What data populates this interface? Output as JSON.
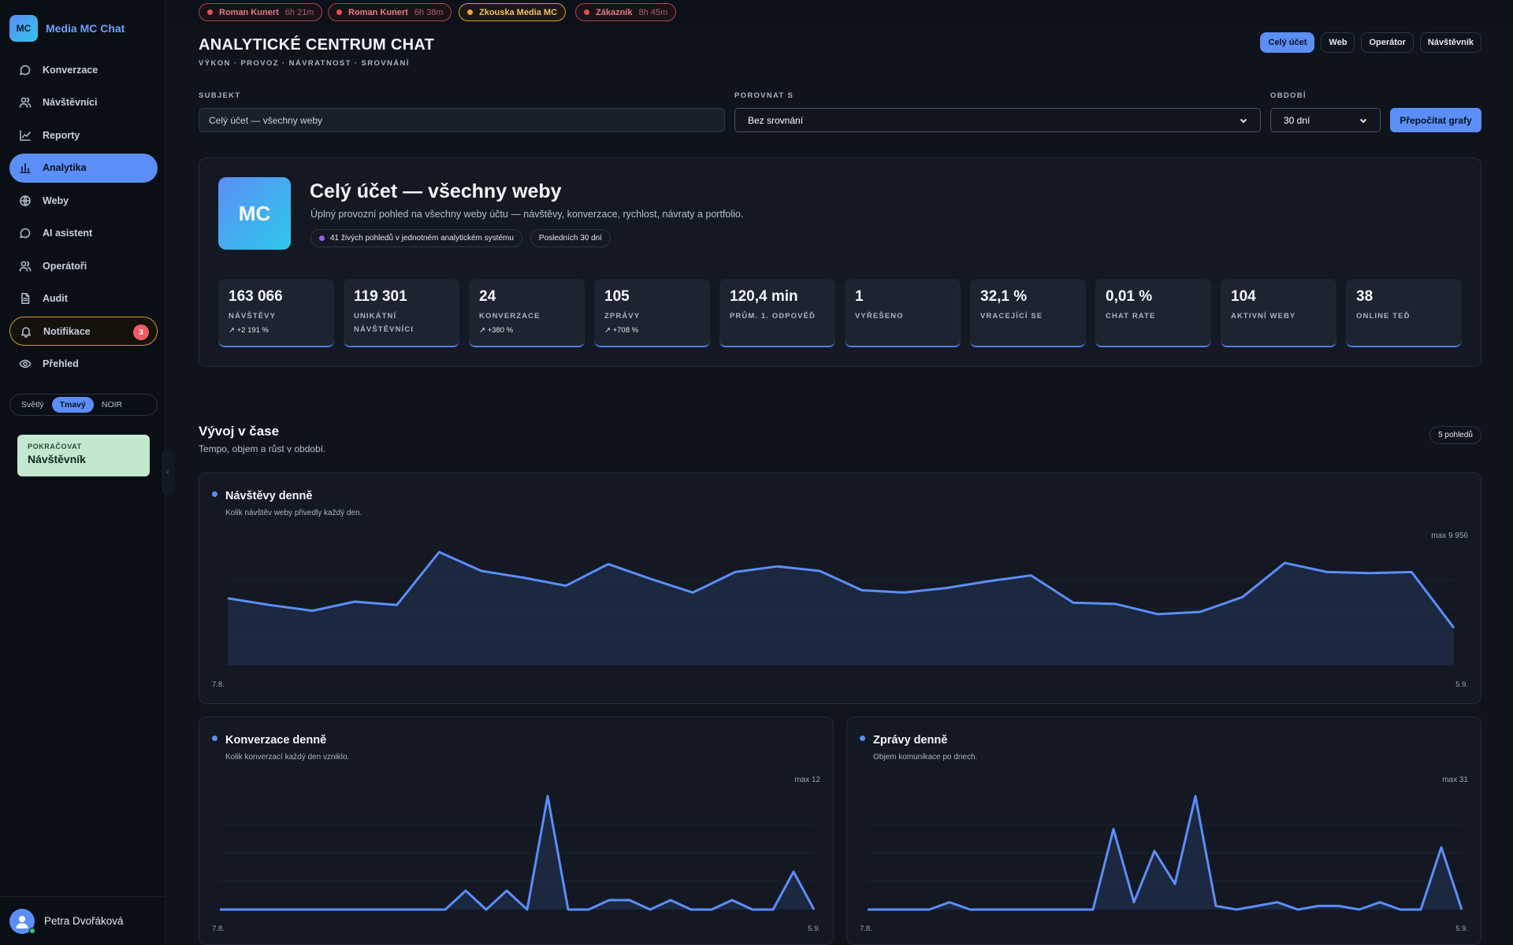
{
  "app": {
    "logo": "MC",
    "name": "Media MC Chat"
  },
  "sidebar": {
    "items": [
      {
        "label": "Konverzace",
        "icon": "chat-bubble-icon"
      },
      {
        "label": "Návštěvníci",
        "icon": "users-icon"
      },
      {
        "label": "Reporty",
        "icon": "line-chart-icon"
      },
      {
        "label": "Analytika",
        "icon": "bar-chart-icon",
        "active": true
      },
      {
        "label": "Weby",
        "icon": "globe-icon"
      },
      {
        "label": "AI asistent",
        "icon": "chat-bubble-icon"
      },
      {
        "label": "Operátoři",
        "icon": "users-icon"
      },
      {
        "label": "Audit",
        "icon": "document-icon"
      },
      {
        "label": "Notifikace",
        "icon": "bell-icon",
        "badge": "3"
      },
      {
        "label": "Přehled",
        "icon": "eye-icon"
      }
    ],
    "theme": {
      "options": [
        "Světlý",
        "Tmavý",
        "NOIR"
      ],
      "selected": "Tmavý"
    },
    "continue_card": {
      "label": "POKRAČOVAT",
      "value": "Návštěvník"
    },
    "user": {
      "name": "Petra Dvořáková"
    }
  },
  "sessions": [
    {
      "name": "Roman Kunert",
      "time": "6h 21m"
    },
    {
      "name": "Roman Kunert",
      "time": "6h 38m"
    },
    {
      "name": "Zkouska Media MC",
      "time": "",
      "active": true
    },
    {
      "name": "Zákazník",
      "time": "8h 45m"
    }
  ],
  "header": {
    "title": "ANALYTICKÉ CENTRUM CHAT",
    "subtitle": "VÝKON · PROVOZ · NÁVRATNOST · SROVNÁNÍ",
    "view_tabs": [
      "Celý účet",
      "Web",
      "Operátor",
      "Návštěvník"
    ],
    "active_view": "Celý účet"
  },
  "filters": {
    "subject_label": "SUBJEKT",
    "subject_value": "Celý účet — všechny weby",
    "compare_label": "POROVNAT S",
    "compare_value": "Bez srovnání",
    "period_label": "OBDOBÍ",
    "period_value": "30 dní",
    "recalc_label": "Přepočítat grafy"
  },
  "overview": {
    "logo": "MC",
    "title": "Celý účet — všechny weby",
    "description": "Úplný provozní pohled na všechny weby účtu — návštěvy, konverzace, rychlost, návraty a portfolio.",
    "chip_live": "41 živých pohledů v jednotném analytickém systému",
    "chip_period": "Posledních 30 dní",
    "kpis": [
      {
        "value": "163 066",
        "label": "NÁVŠTĚVY",
        "delta": "↗ +2 191 %"
      },
      {
        "value": "119 301",
        "label": "UNIKÁTNÍ NÁVŠTĚVNÍCI",
        "delta": ""
      },
      {
        "value": "24",
        "label": "KONVERZACE",
        "delta": "↗ +380 %"
      },
      {
        "value": "105",
        "label": "ZPRÁVY",
        "delta": "↗ +708 %"
      },
      {
        "value": "120,4 min",
        "label": "PRŮM. 1. ODPOVĚĎ",
        "delta": ""
      },
      {
        "value": "1",
        "label": "VYŘEŠENO",
        "delta": ""
      },
      {
        "value": "32,1 %",
        "label": "VRACEJÍCÍ SE",
        "delta": ""
      },
      {
        "value": "0,01 %",
        "label": "CHAT RATE",
        "delta": ""
      },
      {
        "value": "104",
        "label": "AKTIVNÍ WEBY",
        "delta": ""
      },
      {
        "value": "38",
        "label": "ONLINE TEĎ",
        "delta": ""
      }
    ]
  },
  "timeline": {
    "title": "Vývoj v čase",
    "subtitle": "Tempo, objem a růst v období.",
    "count": "5 pohledů"
  },
  "chart_data": [
    {
      "type": "area",
      "title": "Návštěvy denně",
      "subtitle": "Kolik návštěv weby přivedly každý den.",
      "max_label": "max 9 956",
      "ylim": [
        0,
        9956
      ],
      "x_start": "7.8.",
      "x_end": "5.9.",
      "values": [
        5900,
        5300,
        4800,
        5600,
        5300,
        9956,
        8300,
        7700,
        7000,
        8900,
        7600,
        6400,
        8200,
        8700,
        8300,
        6600,
        6400,
        6800,
        7400,
        7900,
        5500,
        5400,
        4500,
        4700,
        6000,
        9000,
        8200,
        8100,
        8200,
        3300
      ],
      "color": "#5b8ef7"
    },
    {
      "type": "area",
      "title": "Konverzace denně",
      "subtitle": "Kolik konverzací každý den vzniklo.",
      "max_label": "max 12",
      "ylim": [
        0,
        12
      ],
      "x_start": "7.8.",
      "x_end": "5.9.",
      "values": [
        0,
        0,
        0,
        0,
        0,
        0,
        0,
        0,
        0,
        0,
        0,
        0,
        2,
        0,
        2,
        0,
        12,
        0,
        0,
        1,
        1,
        0,
        1,
        0,
        0,
        1,
        0,
        0,
        4,
        0
      ],
      "color": "#5b8ef7"
    },
    {
      "type": "area",
      "title": "Zprávy denně",
      "subtitle": "Objem komunikace po dnech.",
      "max_label": "max 31",
      "ylim": [
        0,
        31
      ],
      "x_start": "7.8.",
      "x_end": "5.9.",
      "values": [
        0,
        0,
        0,
        0,
        2,
        0,
        0,
        0,
        0,
        0,
        0,
        0,
        22,
        2,
        16,
        7,
        31,
        1,
        0,
        1,
        2,
        0,
        1,
        1,
        0,
        2,
        0,
        0,
        17,
        0
      ],
      "color": "#5b8ef7"
    }
  ]
}
